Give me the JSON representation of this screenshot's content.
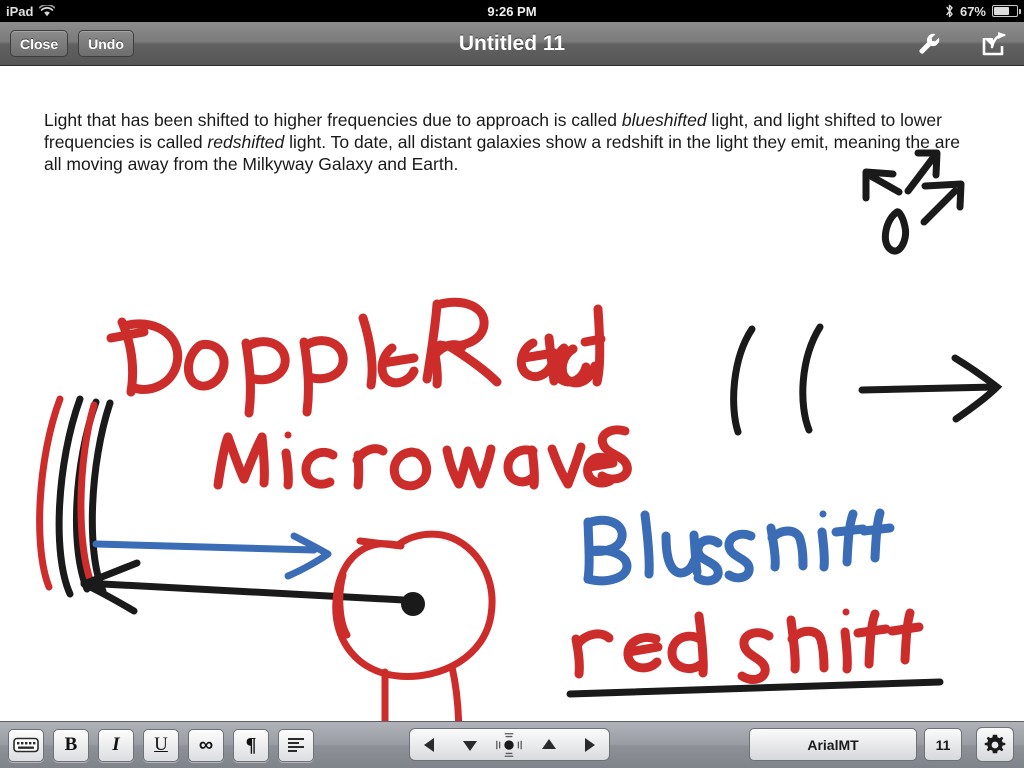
{
  "statusbar": {
    "device_label": "iPad",
    "wifi_icon": "wifi-icon",
    "time": "9:26 PM",
    "bluetooth_icon": "bluetooth-icon",
    "battery_percent": "67%",
    "battery_icon": "battery-icon"
  },
  "navbar": {
    "close_label": "Close",
    "undo_label": "Undo",
    "title": "Untitled 11",
    "wrench_icon": "wrench-icon",
    "share_icon": "share-icon"
  },
  "document": {
    "paragraph_part1": "Light that has been shifted to higher frequencies due to approach is called ",
    "paragraph_em1": "blueshifted",
    "paragraph_part2": " light, and light shifted to lower frequencies is called ",
    "paragraph_em2": "redshifted",
    "paragraph_part3": " light.  To date, all distant galaxies show a redshift in the light they emit, meaning the are all moving away from the Milkyway Galaxy and Earth."
  },
  "ink": {
    "colors": {
      "red": "#CC2C2A",
      "blue": "#3A6DB5",
      "black": "#1A1A1A"
    },
    "annotations": [
      {
        "text": "Doppler",
        "color_key": "red",
        "name": "ink-doppler"
      },
      {
        "text": "Radar",
        "color_key": "red",
        "name": "ink-radar"
      },
      {
        "text": "Microwaves",
        "color_key": "red",
        "name": "ink-microwaves"
      },
      {
        "text": "Blue shift",
        "color_key": "blue",
        "name": "ink-blue-shift"
      },
      {
        "text": "red shift",
        "color_key": "red",
        "name": "ink-red-shift"
      }
    ],
    "shapes": [
      {
        "name": "ink-expansion-arrows",
        "desc": "three arrows radiating from small oval"
      },
      {
        "name": "ink-wavefront-arrows",
        "desc": "two arcs and a right arrow"
      },
      {
        "name": "ink-wave-arcs-left",
        "desc": "stacked red and black arcs (compressed wavefronts)"
      },
      {
        "name": "ink-blue-arrow-right",
        "desc": "blue arrow pointing right"
      },
      {
        "name": "ink-black-arrow-left",
        "desc": "black arrow pointing left"
      },
      {
        "name": "ink-red-observer",
        "desc": "red circle with two legs and black center dot"
      },
      {
        "name": "ink-redshift-underline",
        "desc": "black underline below red shift"
      }
    ]
  },
  "toolbar": {
    "keyboard_icon": "keyboard-icon",
    "bold_label": "B",
    "italic_label": "I",
    "underline_label": "U",
    "infinity_label": "∞",
    "pilcrow_label": "¶",
    "align_icon": "align-left-icon",
    "nav_left_icon": "arrow-left-icon",
    "nav_down_icon": "arrow-down-icon",
    "nav_handle_icon": "drag-handle-icon",
    "nav_up_icon": "arrow-up-icon",
    "nav_right_icon": "arrow-right-icon",
    "font_name": "ArialMT",
    "font_size": "11",
    "gear_icon": "gear-icon"
  }
}
